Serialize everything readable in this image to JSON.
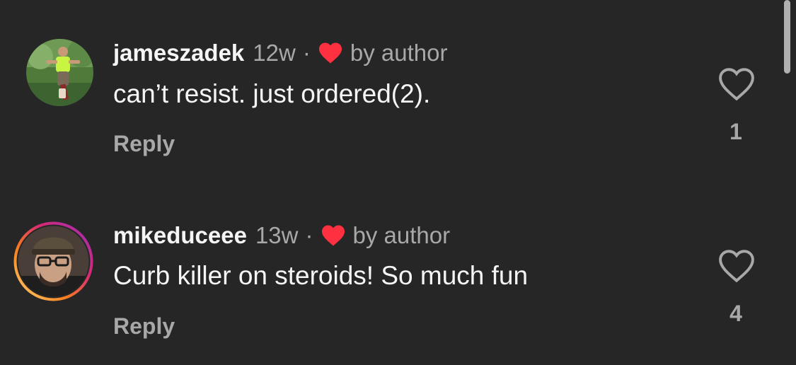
{
  "comments": [
    {
      "username": "jameszadek",
      "time": "12w",
      "separator": "·",
      "author_label": "by author",
      "text": "can’t resist. just ordered(2).",
      "reply_label": "Reply",
      "like_count": "1",
      "avatar_icon": "skateboarder-photo"
    },
    {
      "username": "mikeduceee",
      "time": "13w",
      "separator": "·",
      "author_label": "by author",
      "text": "Curb killer on steroids! So much fun",
      "reply_label": "Reply",
      "like_count": "4",
      "avatar_icon": "profile-photo-with-story-ring"
    }
  ],
  "colors": {
    "background": "#262626",
    "author_heart": "#ff3040",
    "secondary_text": "#a8a8a8",
    "primary_text": "#f5f5f5"
  }
}
